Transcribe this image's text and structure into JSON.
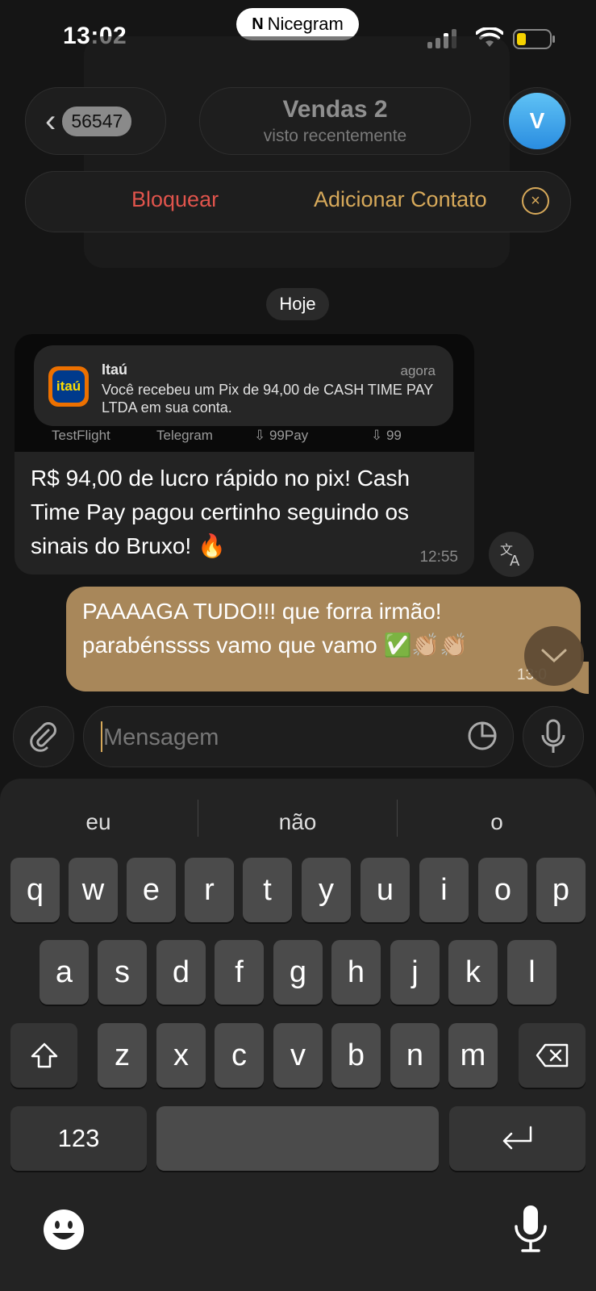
{
  "status_bar": {
    "time": "13:02",
    "carrier": "Nicegram"
  },
  "header": {
    "back_count": "56547",
    "chat_name": "Vendas 2",
    "chat_status": "visto recentemente",
    "avatar_initial": "V"
  },
  "action_bar": {
    "block_label": "Bloquear",
    "add_contact_label": "Adicionar Contato"
  },
  "date_chip": "Hoje",
  "messages": [
    {
      "direction": "incoming",
      "screenshot": {
        "app": "Itaú",
        "time": "agora",
        "body": "Você recebeu um Pix de 94,00 de CASH TIME PAY LTDA em sua conta.",
        "dock": [
          "TestFlight",
          "Telegram",
          "99Pay",
          "99"
        ]
      },
      "text": "R$ 94,00 de lucro rápido no pix! Cash Time Pay pagou certinho seguindo os sinais do Bruxo! 🔥",
      "time": "12:55"
    },
    {
      "direction": "outgoing",
      "text": "PAAAAGA TUDO!!! que forra irmão! parabénssss vamo que vamo ✅👏🏼👏🏼",
      "time": "13:0"
    }
  ],
  "composer": {
    "placeholder": "Mensagem"
  },
  "keyboard": {
    "suggestions": [
      "eu",
      "não",
      "o"
    ],
    "row1": [
      "q",
      "w",
      "e",
      "r",
      "t",
      "y",
      "u",
      "i",
      "o",
      "p"
    ],
    "row2": [
      "a",
      "s",
      "d",
      "f",
      "g",
      "h",
      "j",
      "k",
      "l"
    ],
    "row3": [
      "z",
      "x",
      "c",
      "v",
      "b",
      "n",
      "m"
    ],
    "numbers_key": "123"
  },
  "colors": {
    "accent": "#d7a95a",
    "danger": "#e0544c",
    "outgoing_bubble": "#a8875a",
    "avatar": "#3aa3ea"
  }
}
